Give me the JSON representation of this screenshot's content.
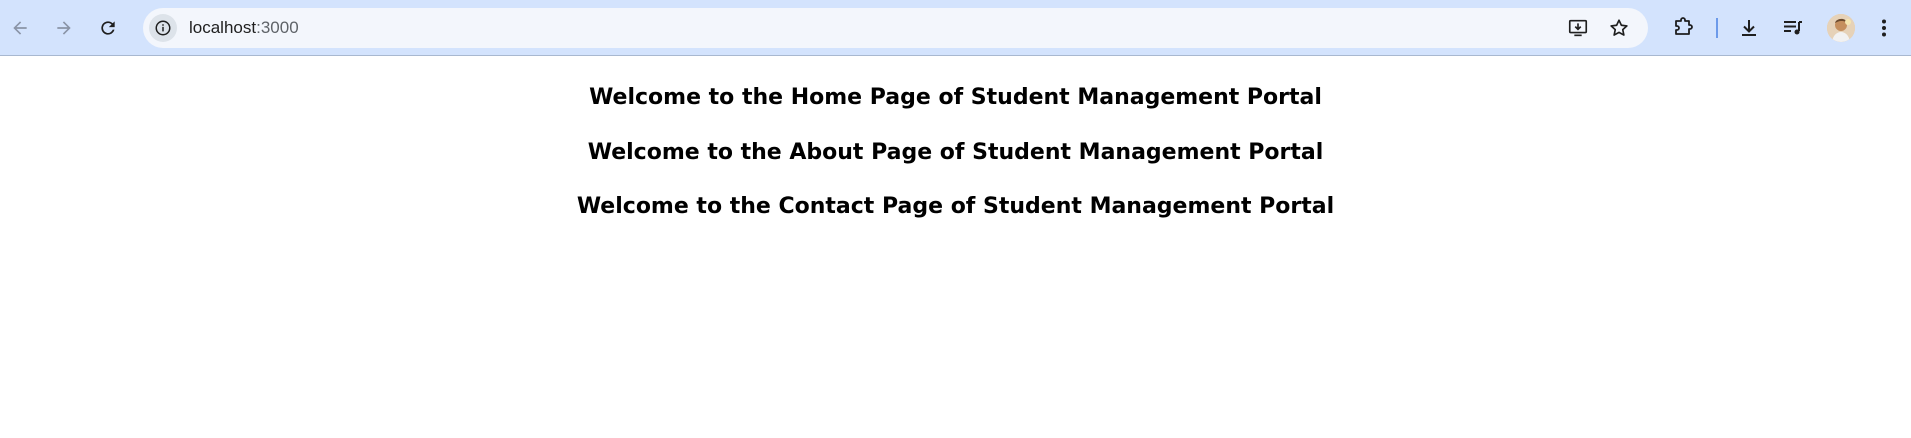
{
  "browser": {
    "url_host": "localhost",
    "url_port": ":3000",
    "icons": {
      "back": "arrow-left-icon",
      "forward": "arrow-right-icon",
      "reload": "reload-icon",
      "site_info": "info-icon",
      "install": "install-app-icon",
      "bookmark": "star-icon",
      "extensions": "puzzle-icon",
      "downloads": "download-icon",
      "media": "media-queue-icon",
      "menu": "kebab-menu-icon"
    },
    "colors": {
      "toolbar": "#d3e3fd",
      "omnibox": "#f3f6fc",
      "divider": "#6c9aea"
    }
  },
  "page": {
    "headings": [
      "Welcome to the Home Page of Student Management Portal",
      "Welcome to the About Page of Student Management Portal",
      "Welcome to the Contact Page of Student Management Portal"
    ]
  }
}
